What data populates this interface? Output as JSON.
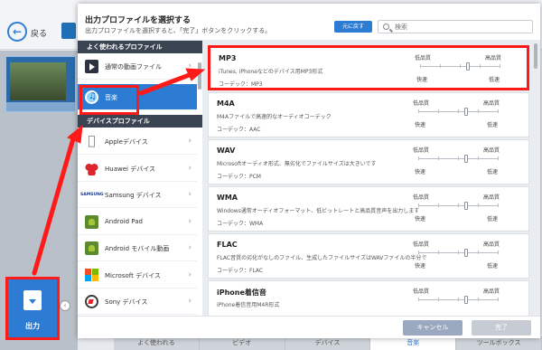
{
  "app": {
    "back_label": "戻る",
    "output_label": "出力",
    "small_circle": "‹",
    "bottom_tabs": [
      "よく使われる",
      "ビデオ",
      "デバイス",
      "音楽",
      "ツールボックス"
    ],
    "bottom_active_index": 3
  },
  "dialog": {
    "title": "出力プロファイルを選択する",
    "subtitle": "出力プロファイルを選択すると、「完了」ボタンをクリックする。",
    "reset_label": "元に戻す",
    "search_placeholder": "検索",
    "cancel_label": "キャンセル",
    "done_label": "完了"
  },
  "categories": {
    "favorites_header": "よく使われるプロファイル",
    "device_header": "デバイスプロファイル",
    "favorites": [
      {
        "label": "通常の動画ファイル",
        "icon": "video-file-icon"
      },
      {
        "label": "音楽",
        "icon": "music-icon",
        "selected": true
      }
    ],
    "devices": [
      {
        "label": "Appleデバイス",
        "icon": "apple-icon"
      },
      {
        "label": "Huawei デバイス",
        "icon": "huawei-icon"
      },
      {
        "label": "Samsung デバイス",
        "icon": "samsung-icon"
      },
      {
        "label": "Android Pad",
        "icon": "android-pad-icon"
      },
      {
        "label": "Android モバイル動画",
        "icon": "android-mobile-icon"
      },
      {
        "label": "Microsoft デバイス",
        "icon": "microsoft-icon"
      },
      {
        "label": "Sony デバイス",
        "icon": "sony-icon"
      }
    ],
    "chevron": "›",
    "samsung_logo_text": "SAMSUNG"
  },
  "profiles": {
    "quality_low": "低品質",
    "quality_high": "高品質",
    "speed_fast": "快速",
    "speed_slow": "低速",
    "items": [
      {
        "title": "MP3",
        "desc": "iTunes, iPhoneなどのデバイス用MP3形式",
        "codec": "コーデック：MP3",
        "level": 0.6,
        "highlighted": true
      },
      {
        "title": "M4A",
        "desc": "M4Aファイルで高速的なオーディオコーデック",
        "codec": "コーデック：AAC",
        "level": 0.6
      },
      {
        "title": "WAV",
        "desc": "Microsoftオーディオ形式、無劣化でファイルサイズは大きいです",
        "codec": "コーデック：PCM",
        "level": 0.6
      },
      {
        "title": "WMA",
        "desc": "Windows通常オーディオフォーマット、低ビットレートと高品質音声を出力します",
        "codec": "コーデック：WMA",
        "level": 0.6
      },
      {
        "title": "FLAC",
        "desc": "FLAC音質の劣化がなしのファイル、生成したファイルサイズはWAVファイルの半分で",
        "codec": "コーデック：FLAC",
        "level": 0.6
      },
      {
        "title": "iPhone着信音",
        "desc": "iPhone着信音用M4R形式",
        "codec": "",
        "level": 0.6
      }
    ]
  },
  "colors": {
    "accent": "#2d7cd3",
    "annotation": "#ff1a1a",
    "section_header": "#3b4452"
  }
}
